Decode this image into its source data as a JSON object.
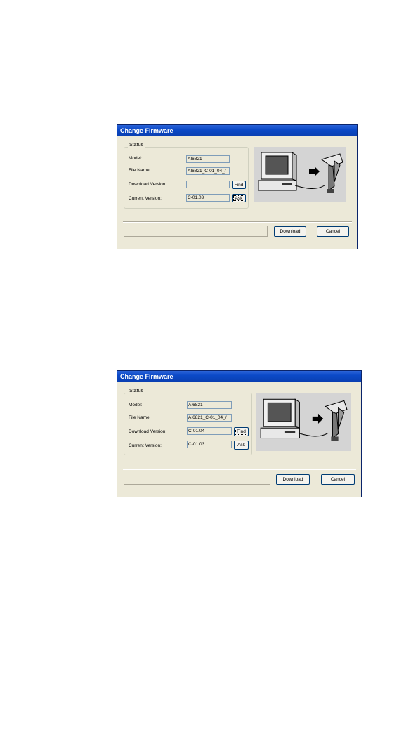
{
  "dialogs": [
    {
      "title": "Change Firmware",
      "group_label": "Status",
      "model_label": "Model:",
      "model_value": "AI6821",
      "filename_label": "File Name:",
      "filename_value": "AI6821_C-01_04_/",
      "download_version_label": "Download Version:",
      "download_version_value": "",
      "current_version_label": "Current Version:",
      "current_version_value": "C-01.03",
      "find_button": "Find",
      "ask_button": "Ask",
      "download_button": "Download",
      "cancel_button": "Cancel",
      "focused_button": "ask"
    },
    {
      "title": "Change Firmware",
      "group_label": "Status",
      "model_label": "Model:",
      "model_value": "AI6821",
      "filename_label": "File Name:",
      "filename_value": "AI6821_C-01_04_/",
      "download_version_label": "Download Version:",
      "download_version_value": "C-01.04",
      "current_version_label": "Current Version:",
      "current_version_value": "C-01.03",
      "find_button": "Find",
      "ask_button": "Ask",
      "download_button": "Download",
      "cancel_button": "Cancel",
      "focused_button": "find"
    }
  ],
  "illustration": {
    "icon": "computer-scanner-icon"
  }
}
